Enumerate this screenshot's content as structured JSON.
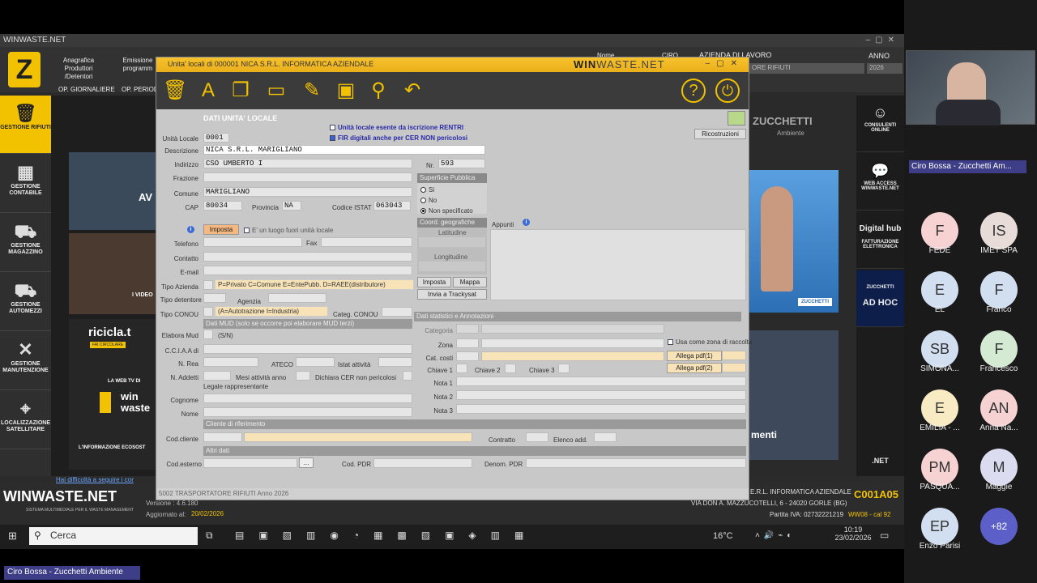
{
  "bg_window": {
    "title": "WINWASTE.NET"
  },
  "app_top": {
    "anagrafica": "Anagrafica",
    "produttori": "Produttori /Detentori",
    "emissione": "Emissione",
    "programmi": "programm",
    "op_giornaliere": "OP. GIORNALIERE",
    "op_period": "OP. PERIOD",
    "nome": "Nome",
    "ciro": "CIRO",
    "azienda_lavoro": "AZIENDA DI LAVORO",
    "rifiuti": "ORE RIFIUTI",
    "anno_label": "ANNO",
    "anno_value": "2026"
  },
  "sidebar": {
    "items": [
      "GESTIONE RIFIUTI",
      "GESTIONE CONTABILE",
      "GESTIONE MAGAZZINO",
      "GESTIONE AUTOMEZZI",
      "GESTIONE MANUTENZIONE",
      "LOCALIZZAZIONE SATELLITARE"
    ]
  },
  "center_bg": {
    "av": "AV",
    "video": "I VIDEO",
    "ricicla": "ricicla.t",
    "fai": "FAI CIRCOLARE",
    "la_web_tv": "LA WEB TV DI",
    "win": "win",
    "waste": "waste",
    "informazione": "L'INFORMAZIONE ECOSOST",
    "help": "Hai difficoltà a seguire i cor"
  },
  "right_bg": {
    "zucchetti": "ZUCCHETTI",
    "ambiente": "Ambiente",
    "menti": "menti",
    "badge": "ZUCCHETTI",
    "tiles": [
      "CONSULENTI ONLINE",
      "WEB ACCESS WINWASTE.NET",
      "FATTURAZIONE ELETTRONICA",
      "AD HOC",
      ".NET"
    ],
    "digital": "Digital hub",
    "adhoc_top": "ZUCCHETTI"
  },
  "footer_app": {
    "brand": "WINWASTE.NET",
    "tagline": "SISTEMA MULTIMEDIALE PER IL WASTE MANAGEMENT",
    "versione": "Versione : 4.6.180",
    "aggiornato_label": "Aggiornato al:",
    "aggiornato_value": "20/02/2026",
    "company": "E.R.L. INFORMATICA AZIENDALE",
    "address": "VIA DON A. MAZZUCOTELLI, 6 - 24020 GORLE (BG)",
    "piva": "Partita IVA: 02732221219",
    "code": "C001A05",
    "week": "WW08 - cal 92"
  },
  "dialog": {
    "title": "Unita' locali di 000001 NICA S.R.L. INFORMATICA AZIENDALE",
    "brand": "WIN",
    "brand2": "WASTE.NET",
    "section_title": "DATI UNITA' LOCALE",
    "chk_rentri": "Unità locale esente da iscrizione RENTRI",
    "chk_fir": "FIR digitali anche per CER NON pericolosi",
    "ricostruzioni": "Ricostruzioni",
    "unita_locale_label": "Unità Locale",
    "unita_locale_value": "0001",
    "descrizione_label": "Descrizione",
    "descrizione_value": "NICA S.R.L. MARIGLIANO",
    "indirizzo_label": "Indirizzo",
    "indirizzo_value": "CSO UMBERTO I",
    "nr_label": "Nr.",
    "nr_value": "593",
    "frazione_label": "Frazione",
    "comune_label": "Comune",
    "comune_value": "MARIGLIANO",
    "cap_label": "CAP",
    "cap_value": "80034",
    "provincia_label": "Provincia",
    "provincia_value": "NA",
    "istat_label": "Codice ISTAT",
    "istat_value": "063043",
    "sup_pubblica": "Superficie Pubblica",
    "si": "Si",
    "no": "No",
    "non_spec": "Non specificato",
    "coord": "Coord. geografiche",
    "latitudine": "Latitudine",
    "longitudine": "Longitudine",
    "imposta": "Imposta",
    "mappa": "Mappa",
    "trackysat": "Invia a Trackysat",
    "appunti": "Appunti",
    "imposta_btn": "Imposta",
    "fuori_unita": "E' un luogo fuori unità locale",
    "telefono": "Telefono",
    "fax": "Fax",
    "contatto": "Contatto",
    "email": "E-mail",
    "tipo_azienda": "Tipo Azienda",
    "tipo_azienda_hint": "P=Privato C=Comune E=EntePubb. D=RAEE(distributore)",
    "tipo_detentore": "Tipo detentore",
    "agenzia": "Agenzia",
    "tipo_conou": "Tipo CONOU",
    "tipo_conou_hint": "(A=Autotrazione I=Industria)",
    "categ_conou": "Categ. CONOU",
    "dati_mud": "Dati MUD (solo se occorre poi elaborare MUD terzi)",
    "elabora_mud": "Elabora Mud",
    "sn": "(S/N)",
    "cciaa": "C.C.I.A.A di",
    "nrea": "N. Rea",
    "ateco": "ATECO",
    "istat_att": "Istat attività",
    "naddetti": "N. Addetti",
    "mesi": "Mesi attività anno",
    "dichiara": "Dichiara CER non pericolosi",
    "legale": "Legale rappresentante",
    "cognome": "Cognome",
    "nome": "Nome",
    "dati_stat": "Dati statistici e Annotazioni",
    "categoria": "Categoria",
    "zona": "Zona",
    "cat_costi": "Cat. costi",
    "chiave1": "Chiave 1",
    "chiave2": "Chiave 2",
    "chiave3": "Chiave 3",
    "nota1": "Nota 1",
    "nota2": "Nota 2",
    "nota3": "Nota 3",
    "zona_raccolta": "Usa come zona di raccolta",
    "allega1": "Allega pdf(1)",
    "allega2": "Allega pdf(2)",
    "cliente_rif": "Cliente di riferimento",
    "cod_cliente": "Cod.cliente",
    "contratto": "Contratto",
    "elenco_add": "Elenco add.",
    "altri_dati": "Altri dati",
    "cod_esterno": "Cod.esterno",
    "ellipsis": "...",
    "cod_pdr": "Cod. PDR",
    "denom_pdr": "Denom. PDR",
    "status": "5002 TRASPORTATORE RIFIUTI    Anno 2026"
  },
  "taskbar": {
    "search": "Cerca",
    "temp": "16°C",
    "time": "10:19",
    "date": "23/02/2026"
  },
  "meeting": {
    "presenter": "Ciro Bossa - Zucchetti Am...",
    "bottom_name": "Ciro Bossa - Zucchetti Ambiente",
    "participants": [
      {
        "initials": "F",
        "name": "FEDE",
        "color": "#f6d2d2"
      },
      {
        "initials": "IS",
        "name": "IMET SPA",
        "color": "#e8dcd8"
      },
      {
        "initials": "E",
        "name": "EL",
        "color": "#d2dff0"
      },
      {
        "initials": "F",
        "name": "Franco",
        "color": "#d2dff0"
      },
      {
        "initials": "SB",
        "name": "SIMONA...",
        "color": "#d2dff0"
      },
      {
        "initials": "F",
        "name": "Francesco",
        "color": "#d5ead2"
      },
      {
        "initials": "E",
        "name": "EMILIA - ...",
        "color": "#f8eac2"
      },
      {
        "initials": "AN",
        "name": "Anna Na...",
        "color": "#f6d2d2"
      },
      {
        "initials": "PM",
        "name": "PASQUA...",
        "color": "#f6d2d2"
      },
      {
        "initials": "M",
        "name": "Maggie",
        "color": "#dcdcf0"
      },
      {
        "initials": "EP",
        "name": "Enzo Parisi",
        "color": "#d2dff0"
      },
      {
        "initials": "+82",
        "name": "",
        "color": "#5b5fc7"
      }
    ]
  }
}
